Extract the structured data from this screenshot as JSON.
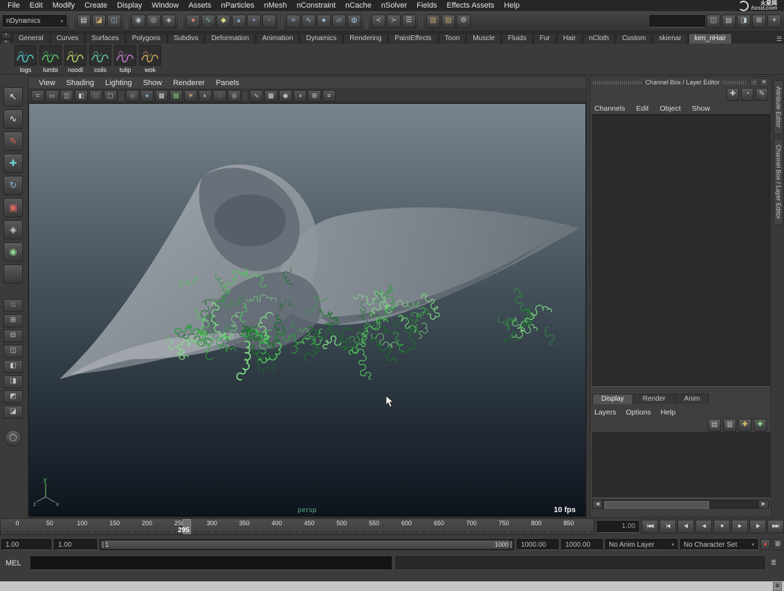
{
  "menu_bar": {
    "items": [
      "File",
      "Edit",
      "Modify",
      "Create",
      "Display",
      "Window",
      "Assets",
      "nParticles",
      "nMesh",
      "nConstraint",
      "nCache",
      "nSolver",
      "Fields",
      "Effects Assets",
      "Help"
    ],
    "logo": {
      "brand": "火星网",
      "domain": "hxsd.com"
    }
  },
  "status_line": {
    "menu_set": "nDynamics",
    "groups": {
      "files": [
        {
          "name": "new-scene-icon",
          "glyph": "▤",
          "tint": "#d8d8d8"
        },
        {
          "name": "open-scene-icon",
          "glyph": "◪",
          "tint": "#d8b46a"
        },
        {
          "name": "save-scene-icon",
          "glyph": "◫",
          "tint": "#8fb6d9"
        }
      ],
      "selection": [
        {
          "name": "select-hierarchy-icon",
          "glyph": "◉",
          "tint": "#b9c4cc"
        },
        {
          "name": "select-object-icon",
          "glyph": "◎",
          "tint": "#b9c4cc"
        },
        {
          "name": "select-component-icon",
          "glyph": "◈",
          "tint": "#b9c4cc"
        }
      ],
      "masks": [
        {
          "name": "mask-points-icon",
          "glyph": "●",
          "tint": "#d97f7f"
        },
        {
          "name": "mask-curves-icon",
          "glyph": "∿",
          "tint": "#7fd98a"
        },
        {
          "name": "mask-surfaces-icon",
          "glyph": "◆",
          "tint": "#d9d97f"
        },
        {
          "name": "mask-deformations-icon",
          "glyph": "▴",
          "tint": "#7fb2d9"
        },
        {
          "name": "mask-dynamics-icon",
          "glyph": "▪",
          "tint": "#c48fd9"
        },
        {
          "name": "mask-misc-icon",
          "glyph": "◦",
          "tint": "#d9a35f"
        }
      ],
      "snaps": [
        {
          "name": "snap-grid-icon",
          "glyph": "⌗",
          "tint": "#9fc7e8"
        },
        {
          "name": "snap-curve-icon",
          "glyph": "∿",
          "tint": "#9fc7e8"
        },
        {
          "name": "snap-point-icon",
          "glyph": "●",
          "tint": "#9fc7e8"
        },
        {
          "name": "snap-view-plane-icon",
          "glyph": "▱",
          "tint": "#9fc7e8"
        },
        {
          "name": "make-live-icon",
          "glyph": "◍",
          "tint": "#9fc7e8"
        }
      ],
      "history": [
        {
          "name": "input-connections-icon",
          "glyph": "≺",
          "tint": "#c9c9c9"
        },
        {
          "name": "output-connections-icon",
          "glyph": "≻",
          "tint": "#c9c9c9"
        },
        {
          "name": "construction-history-icon",
          "glyph": "☰",
          "tint": "#c9c9c9"
        }
      ],
      "render": [
        {
          "name": "render-view-icon",
          "glyph": "▨",
          "tint": "#c9a06a"
        },
        {
          "name": "ipr-render-icon",
          "glyph": "▧",
          "tint": "#c9a06a"
        },
        {
          "name": "render-settings-icon",
          "glyph": "⚙",
          "tint": "#c9c9c9"
        }
      ],
      "right": [
        {
          "name": "show-attribute-editor-icon",
          "glyph": "◫",
          "tint": "#bcc6cd"
        },
        {
          "name": "show-tool-settings-icon",
          "glyph": "▤",
          "tint": "#bcc6cd"
        },
        {
          "name": "show-channel-box-icon",
          "glyph": "◨",
          "tint": "#bcc6cd"
        },
        {
          "name": "ui-elements-icon",
          "glyph": "⊞",
          "tint": "#bcc6cd"
        },
        {
          "name": "toolbar-caret-icon",
          "glyph": "▾",
          "tint": "#aaaaaa"
        }
      ]
    }
  },
  "shelf": {
    "tabs": [
      {
        "label": "General"
      },
      {
        "label": "Curves"
      },
      {
        "label": "Surfaces"
      },
      {
        "label": "Polygons"
      },
      {
        "label": "Subdivs"
      },
      {
        "label": "Deformation"
      },
      {
        "label": "Animation"
      },
      {
        "label": "Dynamics"
      },
      {
        "label": "Rendering"
      },
      {
        "label": "PaintEffects"
      },
      {
        "label": "Toon"
      },
      {
        "label": "Muscle"
      },
      {
        "label": "Fluids"
      },
      {
        "label": "Fur"
      },
      {
        "label": "Hair"
      },
      {
        "label": "nCloth"
      },
      {
        "label": "Custom"
      },
      {
        "label": "skienar"
      },
      {
        "label": "ken_nHair",
        "active": true
      }
    ],
    "items": [
      {
        "label": "logs",
        "tint": "#55c8c8"
      },
      {
        "label": "lumbi",
        "tint": "#59c96a"
      },
      {
        "label": "noodl",
        "tint": "#b7d46a"
      },
      {
        "label": "coils",
        "tint": "#5fc9a0"
      },
      {
        "label": "tulip",
        "tint": "#c97fd0"
      },
      {
        "label": "wok",
        "tint": "#d0a55f"
      }
    ]
  },
  "toolbox": {
    "tools": [
      {
        "name": "select-tool",
        "glyph": "↖",
        "tint": "#e8e8e8"
      },
      {
        "name": "lasso-select-tool",
        "glyph": "∿",
        "tint": "#e8e8e8"
      },
      {
        "name": "paint-select-tool",
        "glyph": "✎",
        "tint": "#d96a5f"
      },
      {
        "name": "move-tool",
        "glyph": "✚",
        "tint": "#6ad0c9"
      },
      {
        "name": "rotate-tool",
        "glyph": "↻",
        "tint": "#7fb2d9"
      },
      {
        "name": "scale-tool",
        "glyph": "▣",
        "tint": "#d96a5f"
      },
      {
        "name": "universal-manip-tool",
        "glyph": "◈",
        "tint": "#c9c9c9"
      },
      {
        "name": "soft-mod-tool",
        "glyph": "◉",
        "tint": "#8fd98f"
      },
      {
        "name": "last-tool-slot",
        "glyph": "",
        "tint": "#888888"
      }
    ],
    "layouts": [
      {
        "name": "layout-single",
        "glyph": "□",
        "tint": "#c5c5c5"
      },
      {
        "name": "layout-four-view",
        "glyph": "⊞",
        "tint": "#c5c5c5"
      },
      {
        "name": "layout-two-stacked",
        "glyph": "⊟",
        "tint": "#c5c5c5"
      },
      {
        "name": "layout-two-side",
        "glyph": "◫",
        "tint": "#c5c5c5"
      },
      {
        "name": "layout-outliner-persp",
        "glyph": "◧",
        "tint": "#c5c5c5"
      },
      {
        "name": "layout-graph-persp",
        "glyph": "◨",
        "tint": "#c5c5c5"
      },
      {
        "name": "layout-hypershade-persp",
        "glyph": "◩",
        "tint": "#c5c5c5"
      },
      {
        "name": "layout-persp-outliner",
        "glyph": "◪",
        "tint": "#c5c5c5"
      }
    ]
  },
  "viewport": {
    "menus": [
      "View",
      "Shading",
      "Lighting",
      "Show",
      "Renderer",
      "Panels"
    ],
    "toolbar": {
      "g1": [
        {
          "name": "grid-toggle-icon",
          "glyph": "⌗",
          "tint": "#c9d2d9"
        },
        {
          "name": "film-gate-icon",
          "glyph": "▭",
          "tint": "#c9d2d9"
        },
        {
          "name": "resolution-gate-icon",
          "glyph": "◫",
          "tint": "#c9d2d9"
        },
        {
          "name": "gate-mask-icon",
          "glyph": "◧",
          "tint": "#c9d2d9"
        },
        {
          "name": "safe-action-icon",
          "glyph": "□",
          "tint": "#c9d2d9"
        },
        {
          "name": "safe-title-icon",
          "glyph": "▢",
          "tint": "#c9d2d9"
        }
      ],
      "g2": [
        {
          "name": "wireframe-mode-icon",
          "glyph": "◇",
          "tint": "#c9d2d9"
        },
        {
          "name": "smooth-shade-icon",
          "glyph": "●",
          "tint": "#7fb2d9"
        },
        {
          "name": "bounding-box-icon",
          "glyph": "▦",
          "tint": "#c9d2d9"
        },
        {
          "name": "textured-mode-icon",
          "glyph": "▨",
          "tint": "#8fd98f"
        },
        {
          "name": "use-lights-icon",
          "glyph": "☀",
          "tint": "#e0c36a"
        },
        {
          "name": "shadows-icon",
          "glyph": "◐",
          "tint": "#c9d2d9"
        },
        {
          "name": "xray-icon",
          "glyph": "◌",
          "tint": "#c9d2d9"
        },
        {
          "name": "isolate-select-icon",
          "glyph": "◎",
          "tint": "#c9d2d9"
        }
      ],
      "g3": [
        {
          "name": "fog-icon",
          "glyph": "∿",
          "tint": "#c9d2d9"
        },
        {
          "name": "multisample-icon",
          "glyph": "▩",
          "tint": "#c9d2d9"
        },
        {
          "name": "depth-of-field-icon",
          "glyph": "◉",
          "tint": "#c9d2d9"
        },
        {
          "name": "exposure-icon",
          "glyph": "◑",
          "tint": "#c9d2d9"
        },
        {
          "name": "viewcube-icon",
          "glyph": "⊞",
          "tint": "#c9d2d9"
        },
        {
          "name": "panel-menu-icon",
          "glyph": "≡",
          "tint": "#c9d2d9"
        }
      ]
    },
    "camera_label": "persp",
    "fps": "10 fps",
    "axis_y": "y",
    "axis_x": "x",
    "axis_z": "z",
    "colors": {
      "bg_top": "#76838d",
      "bg_bottom": "#0d141d",
      "cone_light": "#a8aeb3",
      "cone_dark": "#6c737b",
      "hair": [
        "#1d6f2b",
        "#2f9e3f",
        "#52c75c",
        "#83e486"
      ]
    }
  },
  "channel_box": {
    "title": "Channel Box / Layer Editor",
    "menus": [
      "Channels",
      "Edit",
      "Object",
      "Show"
    ],
    "tools": [
      {
        "name": "channel-manip-icon",
        "glyph": "✚",
        "tint": "#c9c9c9"
      },
      {
        "name": "channel-speed-icon",
        "glyph": "◔",
        "tint": "#c9c9c9"
      },
      {
        "name": "channel-edit-icon",
        "glyph": "✎",
        "tint": "#c9c9c9"
      }
    ],
    "window_buttons": [
      {
        "name": "float-panel-icon",
        "glyph": "▫",
        "close": false
      },
      {
        "name": "close-panel-icon",
        "glyph": "✕",
        "close": true
      }
    ]
  },
  "layer_editor": {
    "tabs": [
      {
        "label": "Display",
        "active": true
      },
      {
        "label": "Render"
      },
      {
        "label": "Anim"
      }
    ],
    "menus": [
      "Layers",
      "Options",
      "Help"
    ],
    "tools": [
      {
        "name": "layer-select-icon",
        "glyph": "▤",
        "tint": "#c9c9c9"
      },
      {
        "name": "layer-stack-icon",
        "glyph": "▥",
        "tint": "#c9c9c9"
      },
      {
        "name": "new-empty-layer-icon",
        "glyph": "✚",
        "tint": "#d9c36a"
      },
      {
        "name": "new-layer-selected-icon",
        "glyph": "✚",
        "tint": "#8fd98f"
      }
    ]
  },
  "side_tabs": [
    "Attribute Editor",
    "Channel Box / Layer Editor"
  ],
  "time_slider": {
    "ticks": [
      "0",
      "50",
      "100",
      "150",
      "200",
      "250",
      "300",
      "350",
      "400",
      "450",
      "500",
      "550",
      "600",
      "650",
      "700",
      "750",
      "800",
      "850"
    ],
    "current_frame": "295",
    "current_time_field": "1.00"
  },
  "playback": {
    "buttons": [
      {
        "name": "go-to-start-button",
        "glyph": "|◀◀"
      },
      {
        "name": "step-back-key-button",
        "glyph": "|◀"
      },
      {
        "name": "step-back-frame-button",
        "glyph": "◀|"
      },
      {
        "name": "play-backwards-button",
        "glyph": "◀"
      },
      {
        "name": "stop-button",
        "glyph": "■",
        "accent": true
      },
      {
        "name": "play-forwards-button",
        "glyph": "▶"
      },
      {
        "name": "step-forward-frame-button",
        "glyph": "|▶"
      },
      {
        "name": "go-to-end-button",
        "glyph": "▶▶|"
      }
    ]
  },
  "range_slider": {
    "playback_start": "1.00",
    "anim_start": "1.00",
    "range_start_label": "1",
    "range_end_label": "1000",
    "anim_end": "1000.00",
    "scene_end": "1000.00",
    "anim_layer": "No Anim Layer",
    "character_set": "No Character Set"
  },
  "command_line": {
    "label": "MEL"
  }
}
